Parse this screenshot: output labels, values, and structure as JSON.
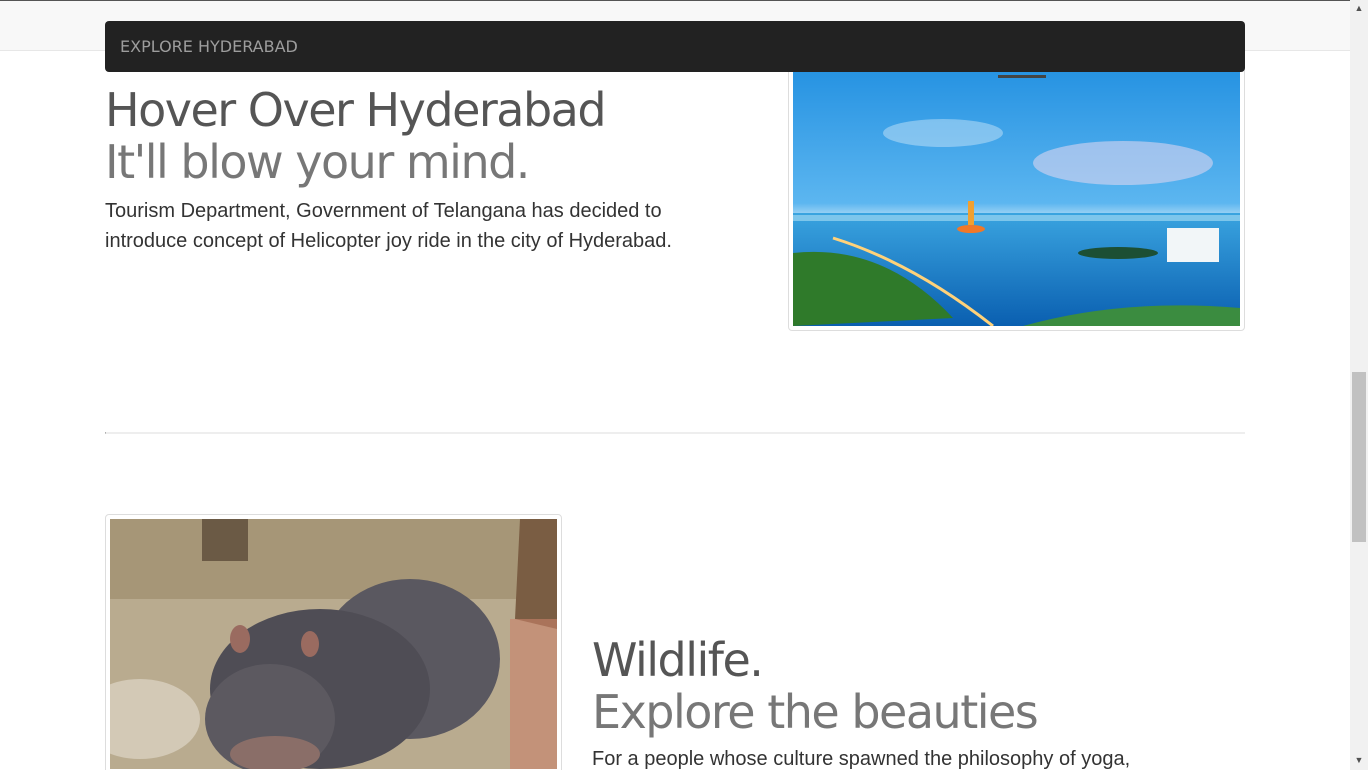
{
  "navbar": {
    "brand": "EXPLORE HYDERABAD"
  },
  "sections": [
    {
      "heading": "Hover Over Hyderabad",
      "subheading": "It'll blow your mind.",
      "text": "Tourism Department, Government of Telangana has decided to introduce concept of Helicopter joy ride in the city of Hyderabad.",
      "image": "hussain-sagar-lake-helicopter-photo"
    },
    {
      "heading": "Wildlife.",
      "subheading": "Explore the beauties",
      "text": "For a people whose culture spawned the philosophy of yoga,",
      "image": "hippopotamus-zoo-photo"
    }
  ],
  "scrollbar": {
    "up_icon": "▲",
    "down_icon": "▼"
  },
  "colors": {
    "navbar_bg": "#222222",
    "navbar_text": "#9d9d9d",
    "heading": "#555555",
    "subheading": "#777777"
  }
}
